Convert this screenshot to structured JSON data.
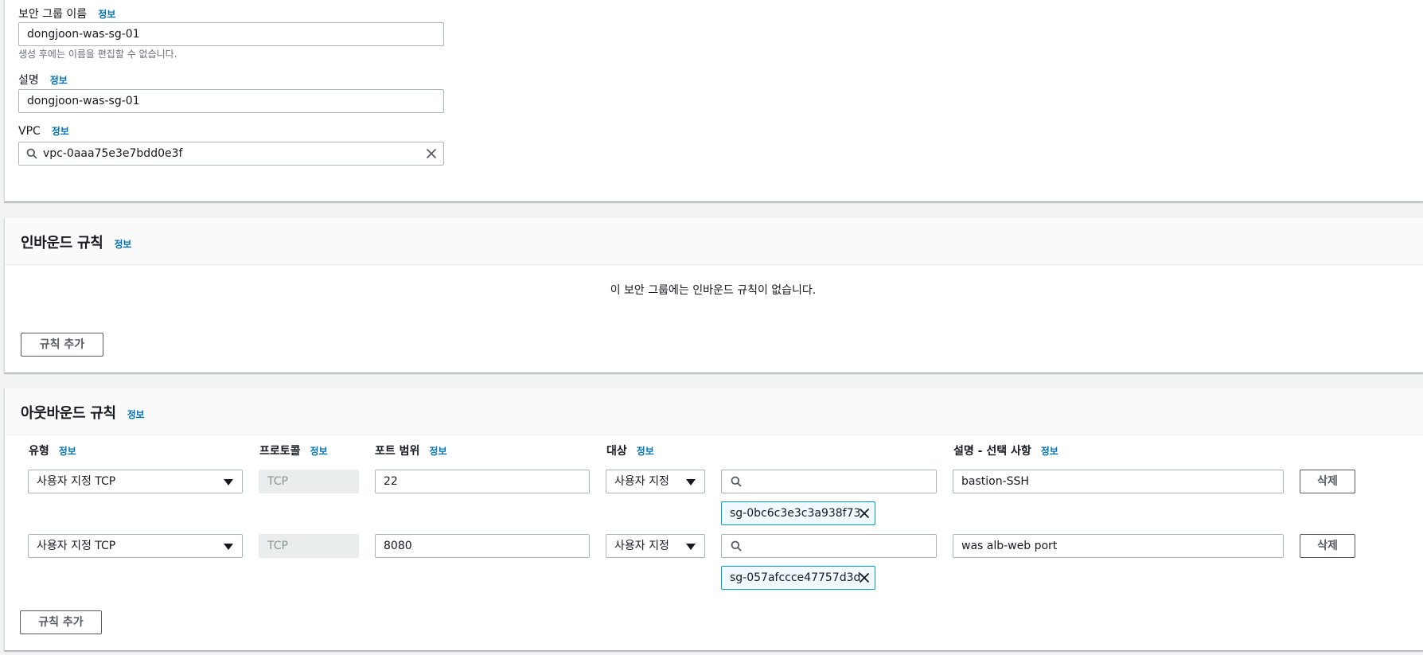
{
  "info_link": "정보",
  "details": {
    "name_label": "보안 그룹 이름",
    "name_value": "dongjoon-was-sg-01",
    "name_helper": "생성 후에는 이름을 편집할 수 없습니다.",
    "description_label": "설명",
    "description_value": "dongjoon-was-sg-01",
    "vpc_label": "VPC",
    "vpc_value": "vpc-0aaa75e3e7bdd0e3f"
  },
  "inbound": {
    "title": "인바운드 규칙",
    "empty_message": "이 보안 그룹에는 인바운드 규칙이 없습니다.",
    "add_rule_label": "규칙 추가"
  },
  "outbound": {
    "title": "아웃바운드 규칙",
    "columns": {
      "type": "유형",
      "protocol": "프로토콜",
      "port_range": "포트 범위",
      "destination": "대상",
      "description": "설명 - 선택 사항"
    },
    "rules": [
      {
        "type": "사용자 지정 TCP",
        "protocol": "TCP",
        "port_range": "22",
        "destination_type": "사용자 지정",
        "destination_search": "",
        "destination_token": "sg-0bc6c3e3c3a938f73",
        "description": "bastion-SSH",
        "delete_label": "삭제"
      },
      {
        "type": "사용자 지정 TCP",
        "protocol": "TCP",
        "port_range": "8080",
        "destination_type": "사용자 지정",
        "destination_search": "",
        "destination_token": "sg-057afccce47757d3d",
        "description": "was alb-web port",
        "delete_label": "삭제"
      }
    ],
    "add_rule_label": "규칙 추가"
  },
  "colors": {
    "link": "#0073bb",
    "token_border": "#00a1c9",
    "token_bg": "#f1faff",
    "page_bg": "#f2f3f3"
  },
  "icons": {
    "search": "search-icon",
    "clear": "close-icon",
    "dropdown": "caret-down-icon"
  }
}
